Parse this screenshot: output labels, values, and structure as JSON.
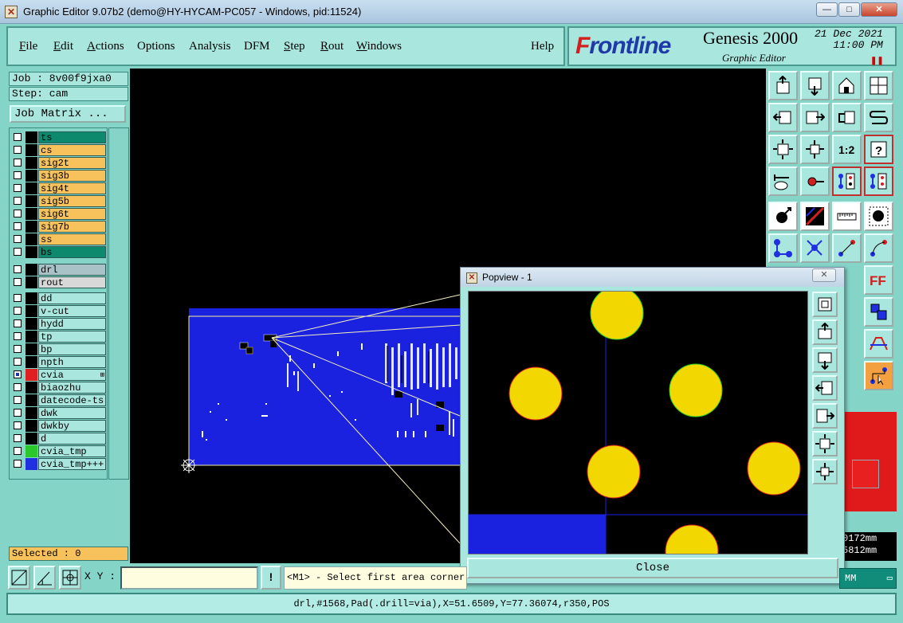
{
  "window": {
    "title": "Graphic Editor 9.07b2 (demo@HY-HYCAM-PC057 - Windows, pid:11524)",
    "controls": {
      "minimize": "—",
      "maximize": "□",
      "close": "✕"
    }
  },
  "menu": [
    "File",
    "Edit",
    "Actions",
    "Options",
    "Analysis",
    "DFM",
    "Step",
    "Rout",
    "Windows",
    "Help"
  ],
  "brand": {
    "logo_prefix": "F",
    "logo_rest": "rontline",
    "product": "Genesis 2000",
    "subtitle": "Graphic Editor",
    "date": "21 Dec 2021",
    "time": "11:00 PM",
    "pause_glyph": "❚❚"
  },
  "job": {
    "job_label": "Job : 8v00f9jxa0",
    "step_label": "Step: cam",
    "matrix_button": "Job Matrix ..."
  },
  "layers": {
    "board": [
      {
        "name": "ts",
        "color": "#0d8a6e",
        "swatch": "#000000"
      },
      {
        "name": "cs",
        "color": "#f7c15c",
        "swatch": "#000000"
      },
      {
        "name": "sig2t",
        "color": "#f7c15c",
        "swatch": "#000000"
      },
      {
        "name": "sig3b",
        "color": "#f7c15c",
        "swatch": "#000000"
      },
      {
        "name": "sig4t",
        "color": "#f7c15c",
        "swatch": "#000000"
      },
      {
        "name": "sig5b",
        "color": "#f7c15c",
        "swatch": "#000000"
      },
      {
        "name": "sig6t",
        "color": "#f7c15c",
        "swatch": "#000000"
      },
      {
        "name": "sig7b",
        "color": "#f7c15c",
        "swatch": "#000000"
      },
      {
        "name": "ss",
        "color": "#f7c15c",
        "swatch": "#000000"
      },
      {
        "name": "bs",
        "color": "#0d8a6e",
        "swatch": "#000000"
      }
    ],
    "drill": [
      {
        "name": "drl",
        "color": "#a9c2c8",
        "swatch": "#000000"
      },
      {
        "name": "rout",
        "color": "#d8d8d8",
        "swatch": "#000000"
      }
    ],
    "misc": [
      {
        "name": "dd",
        "color": "#a8e6de",
        "swatch": "#000000"
      },
      {
        "name": "v-cut",
        "color": "#a8e6de",
        "swatch": "#000000"
      },
      {
        "name": "hydd",
        "color": "#a8e6de",
        "swatch": "#000000"
      },
      {
        "name": "tp",
        "color": "#a8e6de",
        "swatch": "#000000"
      },
      {
        "name": "bp",
        "color": "#a8e6de",
        "swatch": "#000000"
      },
      {
        "name": "npth",
        "color": "#a8e6de",
        "swatch": "#000000"
      },
      {
        "name": "cvia",
        "color": "#a8e6de",
        "swatch": "#e02020",
        "checked": true,
        "marker": "⊞"
      },
      {
        "name": "biaozhu",
        "color": "#a8e6de",
        "swatch": "#000000"
      },
      {
        "name": "datecode-ts",
        "color": "#a8e6de",
        "swatch": "#000000"
      },
      {
        "name": "dwk",
        "color": "#a8e6de",
        "swatch": "#000000"
      },
      {
        "name": "dwkby",
        "color": "#a8e6de",
        "swatch": "#000000"
      },
      {
        "name": "d",
        "color": "#a8e6de",
        "swatch": "#000000"
      },
      {
        "name": "cvia_tmp",
        "color": "#a8e6de",
        "swatch": "#2ac82a"
      },
      {
        "name": "cvia_tmp+++",
        "color": "#a8e6de",
        "swatch": "#2030e0"
      }
    ]
  },
  "selected": "Selected : 0",
  "popview": {
    "title": "Popview - 1",
    "close_glyph": "✕",
    "close_button": "Close"
  },
  "readout": {
    "line1": "0172mm",
    "line2": "5812mm"
  },
  "bottom": {
    "xy_label": "X Y :",
    "xy_value": "",
    "excl": "!",
    "prompt": "<M1> - Select first area corner",
    "units": "MM"
  },
  "status": "drl,#1568,Pad(.drill=via),X=51.6509,Y=77.36074,r350,POS",
  "colors": {
    "board": "#1a22e0",
    "pad": "#f2d800",
    "panel": "#a8e6de",
    "accent_red": "#e02020"
  }
}
